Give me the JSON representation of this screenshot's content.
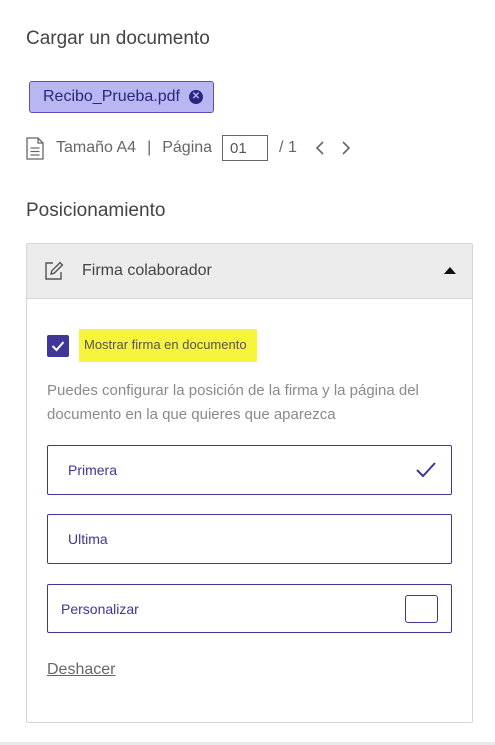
{
  "upload": {
    "title": "Cargar un documento",
    "file_chip": {
      "label": "Recibo_Prueba.pdf",
      "close_icon": "close-circle-icon"
    }
  },
  "doc_info": {
    "icon": "document-icon",
    "size_label": "Tamaño A4",
    "separator": "|",
    "page_label": "Página",
    "page_value": "01",
    "page_total": "/  1",
    "prev_icon": "chevron-left-icon",
    "next_icon": "chevron-right-icon"
  },
  "positioning": {
    "title": "Posicionamiento",
    "panel": {
      "icon": "edit-icon",
      "title": "Firma colaborador",
      "toggle_icon": "caret-up-icon",
      "show_signature": {
        "label": "Mostrar firma en documento",
        "checked": true
      },
      "help_text": "Puedes configurar la posición de la firma y la página del documento en la que quieres que aparezca",
      "options": [
        {
          "label": "Primera",
          "selected": true
        },
        {
          "label": "Ultima",
          "selected": false
        },
        {
          "label": "Personalizar",
          "selected": false,
          "input_value": ""
        }
      ],
      "undo_label": "Deshacer"
    }
  },
  "colors": {
    "accent": "#3f3697",
    "chip_bg": "#b9b7f1",
    "highlight": "#f7f43d"
  }
}
